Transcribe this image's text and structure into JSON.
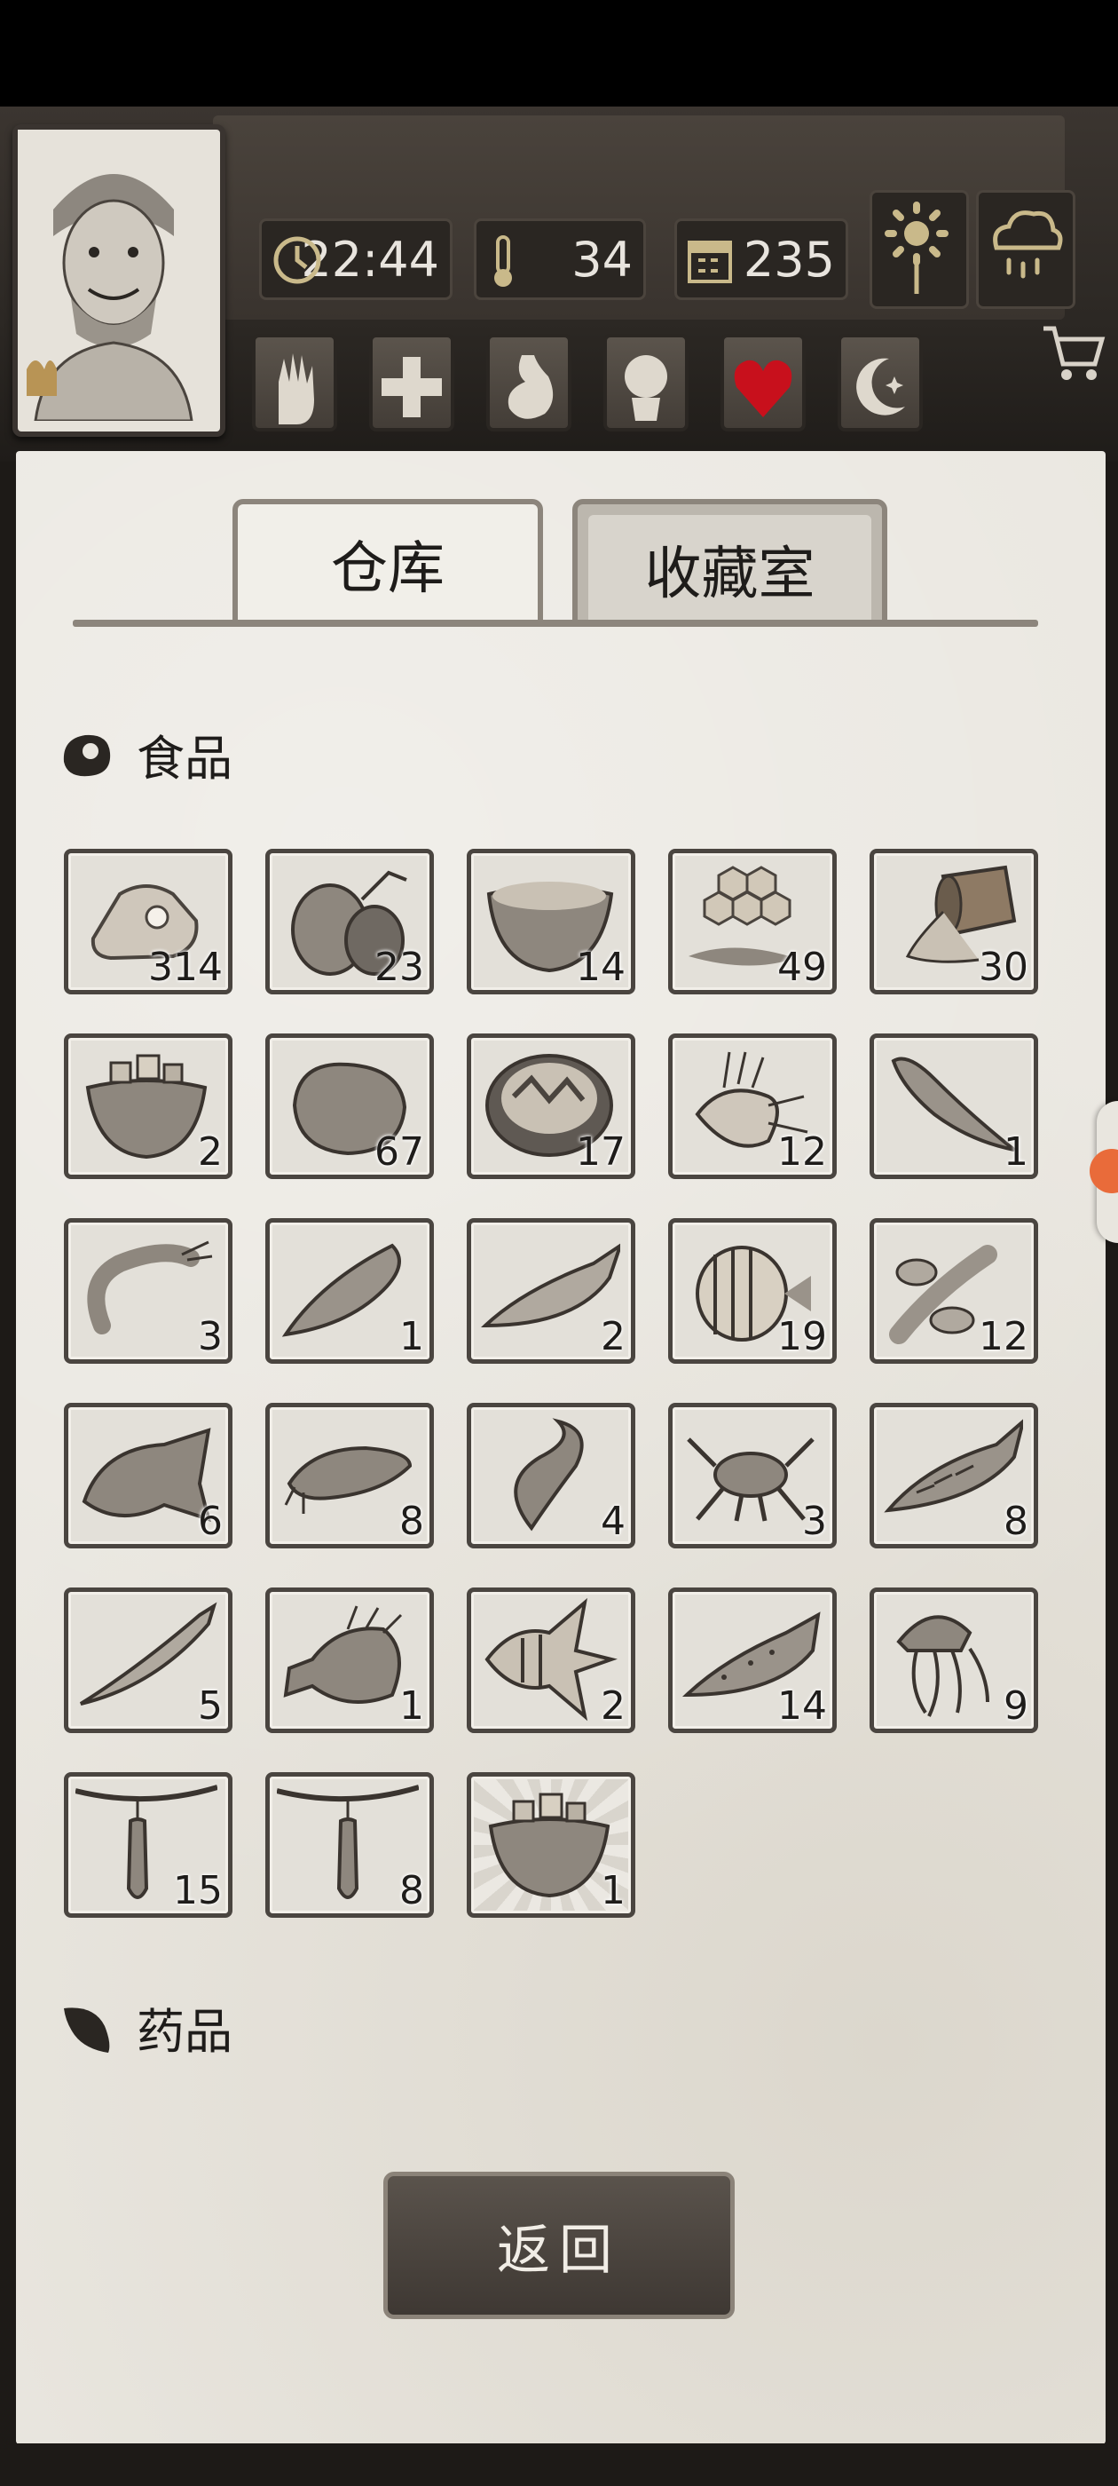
{
  "header": {
    "time": "22:44",
    "temperature": "34",
    "day": "235",
    "icons": [
      "clock-icon",
      "thermometer-icon",
      "calendar-icon",
      "sunflower-icon",
      "rain-cloud-icon",
      "cart-icon"
    ]
  },
  "status_buttons": [
    {
      "name": "hand-bandage-icon"
    },
    {
      "name": "health-cross-icon"
    },
    {
      "name": "stomach-icon"
    },
    {
      "name": "mind-icon"
    },
    {
      "name": "heart-icon"
    },
    {
      "name": "moon-sleep-icon"
    }
  ],
  "tabs": [
    {
      "label": "仓库",
      "active": true
    },
    {
      "label": "收藏室",
      "active": false
    }
  ],
  "sections": {
    "food": {
      "label": "食品"
    },
    "medicine": {
      "label": "药品"
    }
  },
  "items": [
    {
      "name": "meat-icon",
      "qty": "314"
    },
    {
      "name": "coconut-icon",
      "qty": "23"
    },
    {
      "name": "coconut-soup-icon",
      "qty": "14"
    },
    {
      "name": "honeycomb-icon",
      "qty": "49"
    },
    {
      "name": "barrel-icon",
      "qty": "30"
    },
    {
      "name": "coconut-bowl-icon",
      "qty": "2"
    },
    {
      "name": "potato-icon",
      "qty": "67"
    },
    {
      "name": "salad-bowl-icon",
      "qty": "17"
    },
    {
      "name": "lionfish-icon",
      "qty": "12"
    },
    {
      "name": "dried-fish-icon",
      "qty": "1"
    },
    {
      "name": "shrimp-icon",
      "qty": "3"
    },
    {
      "name": "barracuda-icon",
      "qty": "1"
    },
    {
      "name": "salmon-icon",
      "qty": "2"
    },
    {
      "name": "butterflyfish-icon",
      "qty": "19"
    },
    {
      "name": "lobster-icon",
      "qty": "12"
    },
    {
      "name": "grouper-icon",
      "qty": "6"
    },
    {
      "name": "catfish-icon",
      "qty": "8"
    },
    {
      "name": "eel-fish-icon",
      "qty": "4"
    },
    {
      "name": "crab-icon",
      "qty": "3"
    },
    {
      "name": "mackerel-icon",
      "qty": "8"
    },
    {
      "name": "needlefish-icon",
      "qty": "5"
    },
    {
      "name": "rockfish-icon",
      "qty": "1"
    },
    {
      "name": "angelfish-icon",
      "qty": "2"
    },
    {
      "name": "cod-icon",
      "qty": "14"
    },
    {
      "name": "jellyfish-icon",
      "qty": "9"
    },
    {
      "name": "hanging-fruit-icon",
      "qty": "15"
    },
    {
      "name": "hanging-fruit-icon",
      "qty": "8"
    },
    {
      "name": "coconut-bowl-icon",
      "qty": "1"
    }
  ],
  "footer": {
    "back_label": "返回"
  }
}
